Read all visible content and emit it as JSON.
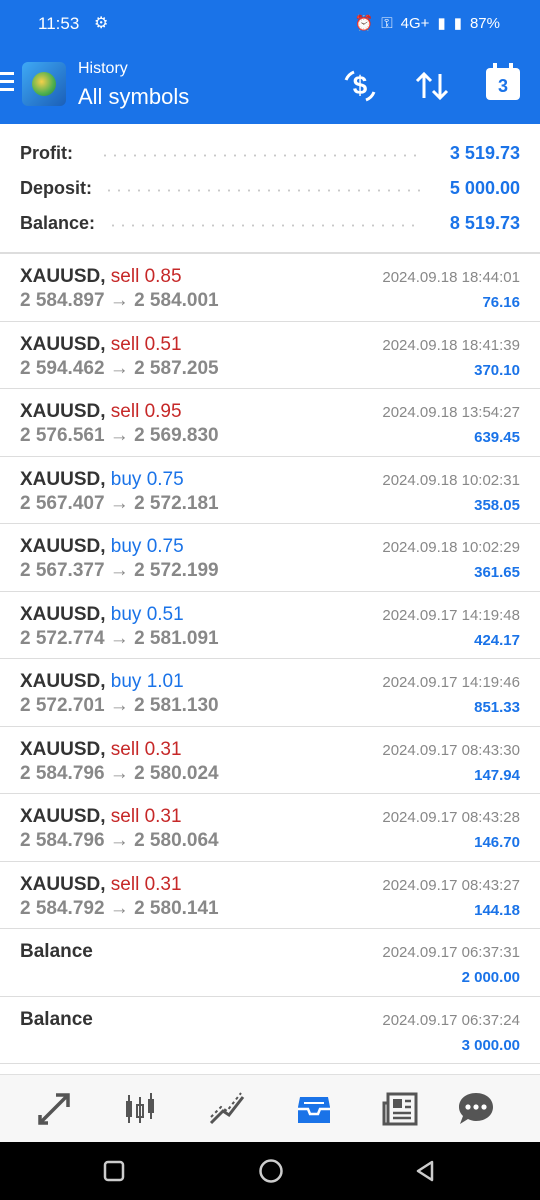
{
  "status": {
    "time": "11:53",
    "battery": "87%",
    "network": "4G+"
  },
  "header": {
    "subtitle": "History",
    "title": "All symbols",
    "calendar_day": "3"
  },
  "summary": [
    {
      "label": "Profit:",
      "value": "3 519.73"
    },
    {
      "label": "Deposit:",
      "value": "5 000.00"
    },
    {
      "label": "Balance:",
      "value": "8 519.73"
    }
  ],
  "deals": [
    {
      "symbol": "XAUUSD,",
      "side": "sell 0.85",
      "prices": "2 584.897 → 2 584.001",
      "time": "2024.09.18 18:44:01",
      "profit": "76.16"
    },
    {
      "symbol": "XAUUSD,",
      "side": "sell 0.51",
      "prices": "2 594.462 → 2 587.205",
      "time": "2024.09.18 18:41:39",
      "profit": "370.10"
    },
    {
      "symbol": "XAUUSD,",
      "side": "sell 0.95",
      "prices": "2 576.561 → 2 569.830",
      "time": "2024.09.18 13:54:27",
      "profit": "639.45"
    },
    {
      "symbol": "XAUUSD,",
      "side": "buy 0.75",
      "prices": "2 567.407 → 2 572.181",
      "time": "2024.09.18 10:02:31",
      "profit": "358.05"
    },
    {
      "symbol": "XAUUSD,",
      "side": "buy 0.75",
      "prices": "2 567.377 → 2 572.199",
      "time": "2024.09.18 10:02:29",
      "profit": "361.65"
    },
    {
      "symbol": "XAUUSD,",
      "side": "buy 0.51",
      "prices": "2 572.774 → 2 581.091",
      "time": "2024.09.17 14:19:48",
      "profit": "424.17"
    },
    {
      "symbol": "XAUUSD,",
      "side": "buy 1.01",
      "prices": "2 572.701 → 2 581.130",
      "time": "2024.09.17 14:19:46",
      "profit": "851.33"
    },
    {
      "symbol": "XAUUSD,",
      "side": "sell 0.31",
      "prices": "2 584.796 → 2 580.024",
      "time": "2024.09.17 08:43:30",
      "profit": "147.94"
    },
    {
      "symbol": "XAUUSD,",
      "side": "sell 0.31",
      "prices": "2 584.796 → 2 580.064",
      "time": "2024.09.17 08:43:28",
      "profit": "146.70"
    },
    {
      "symbol": "XAUUSD,",
      "side": "sell 0.31",
      "prices": "2 584.792 → 2 580.141",
      "time": "2024.09.17 08:43:27",
      "profit": "144.18"
    },
    {
      "symbol": "Balance",
      "side": "",
      "prices": "",
      "time": "2024.09.17 06:37:31",
      "profit": "2 000.00"
    },
    {
      "symbol": "Balance",
      "side": "",
      "prices": "",
      "time": "2024.09.17 06:37:24",
      "profit": "3 000.00"
    }
  ],
  "tabs": [
    {
      "icon": "trade-arrows-icon"
    },
    {
      "icon": "quotes-candles-icon"
    },
    {
      "icon": "chart-icon"
    },
    {
      "icon": "history-inbox-icon",
      "active": true
    },
    {
      "icon": "news-icon"
    },
    {
      "icon": "chat-icon"
    }
  ],
  "colors": {
    "accent": "#1a73e8",
    "sell": "#c62828",
    "buy": "#1a73e8",
    "muted": "#888888"
  }
}
